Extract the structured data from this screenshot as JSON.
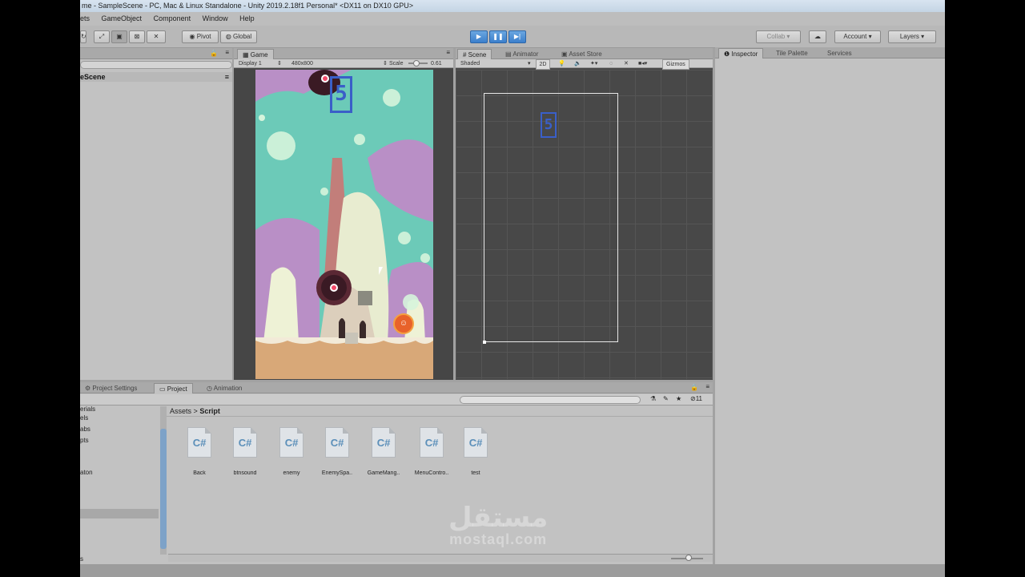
{
  "window": {
    "title": "me - SampleScene - PC, Mac & Linux Standalone - Unity 2019.2.18f1 Personal* <DX11 on DX10 GPU>"
  },
  "menu": [
    "ets",
    "GameObject",
    "Component",
    "Window",
    "Help"
  ],
  "toolbar": {
    "pivot": "Pivot",
    "global": "Global",
    "collab": "Collab ▾",
    "account": "Account",
    "layers": "Layers"
  },
  "hierarchy": {
    "scene_name": "eScene"
  },
  "game": {
    "tab": "Game",
    "display": "Display 1",
    "resolution": "480x800",
    "scale_label": "Scale",
    "scale_value": "0.61"
  },
  "scene": {
    "tab": "Scene",
    "animator_tab": "Animator",
    "asset_store_tab": "Asset Store",
    "shading": "Shaded",
    "mode_2d": "2D",
    "gizmos": "Gizmos",
    "score_text": "5"
  },
  "game_score": "5",
  "inspector": {
    "tab": "Inspector",
    "tile_palette_tab": "Tile Palette",
    "services_tab": "Services"
  },
  "project": {
    "tabs": {
      "settings": "Project Settings",
      "project": "Project",
      "animation": "Animation"
    },
    "breadcrumb": {
      "root": "Assets",
      "sep": ">",
      "current": "Script"
    },
    "sidebar": [
      "erials",
      "els",
      "abs",
      "pts",
      "aton",
      "s"
    ],
    "count": "11",
    "files": [
      {
        "icon": "C#",
        "name": "Back"
      },
      {
        "icon": "C#",
        "name": "btnsound"
      },
      {
        "icon": "C#",
        "name": "enemy"
      },
      {
        "icon": "C#",
        "name": "EnemySpa.."
      },
      {
        "icon": "C#",
        "name": "GameMang.."
      },
      {
        "icon": "C#",
        "name": "MenuContro.."
      },
      {
        "icon": "C#",
        "name": "test"
      }
    ]
  },
  "watermark": {
    "arabic": "مستقل",
    "latin": "mostaql.com"
  },
  "colors": {
    "play_accent": "#3b7fcc",
    "score_blue": "#3a5fc8"
  }
}
